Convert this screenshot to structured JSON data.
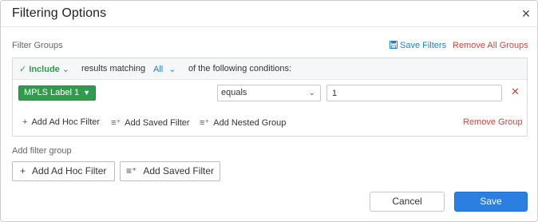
{
  "dialog": {
    "title": "Filtering Options",
    "close_icon": "close-icon"
  },
  "filter_groups": {
    "label": "Filter Groups",
    "save_filters": "Save Filters",
    "remove_all_groups": "Remove All Groups"
  },
  "group": {
    "include_label": "Include",
    "results_matching": "results matching",
    "match_mode": "All",
    "of_following": "of the following conditions:",
    "condition": {
      "field": "MPLS Label 1",
      "operator": "equals",
      "value": "1"
    },
    "add_ad_hoc_filter": "Add Ad Hoc Filter",
    "add_saved_filter": "Add Saved Filter",
    "add_nested_group": "Add Nested Group",
    "remove_group": "Remove Group"
  },
  "add_filter_group": {
    "label": "Add filter group",
    "add_ad_hoc_filter": "Add Ad Hoc Filter",
    "add_saved_filter": "Add Saved Filter"
  },
  "footer": {
    "cancel": "Cancel",
    "save": "Save"
  },
  "colors": {
    "accent_blue": "#2a7fe0",
    "include_green": "#2e9c4a",
    "danger_red": "#d9423b"
  }
}
